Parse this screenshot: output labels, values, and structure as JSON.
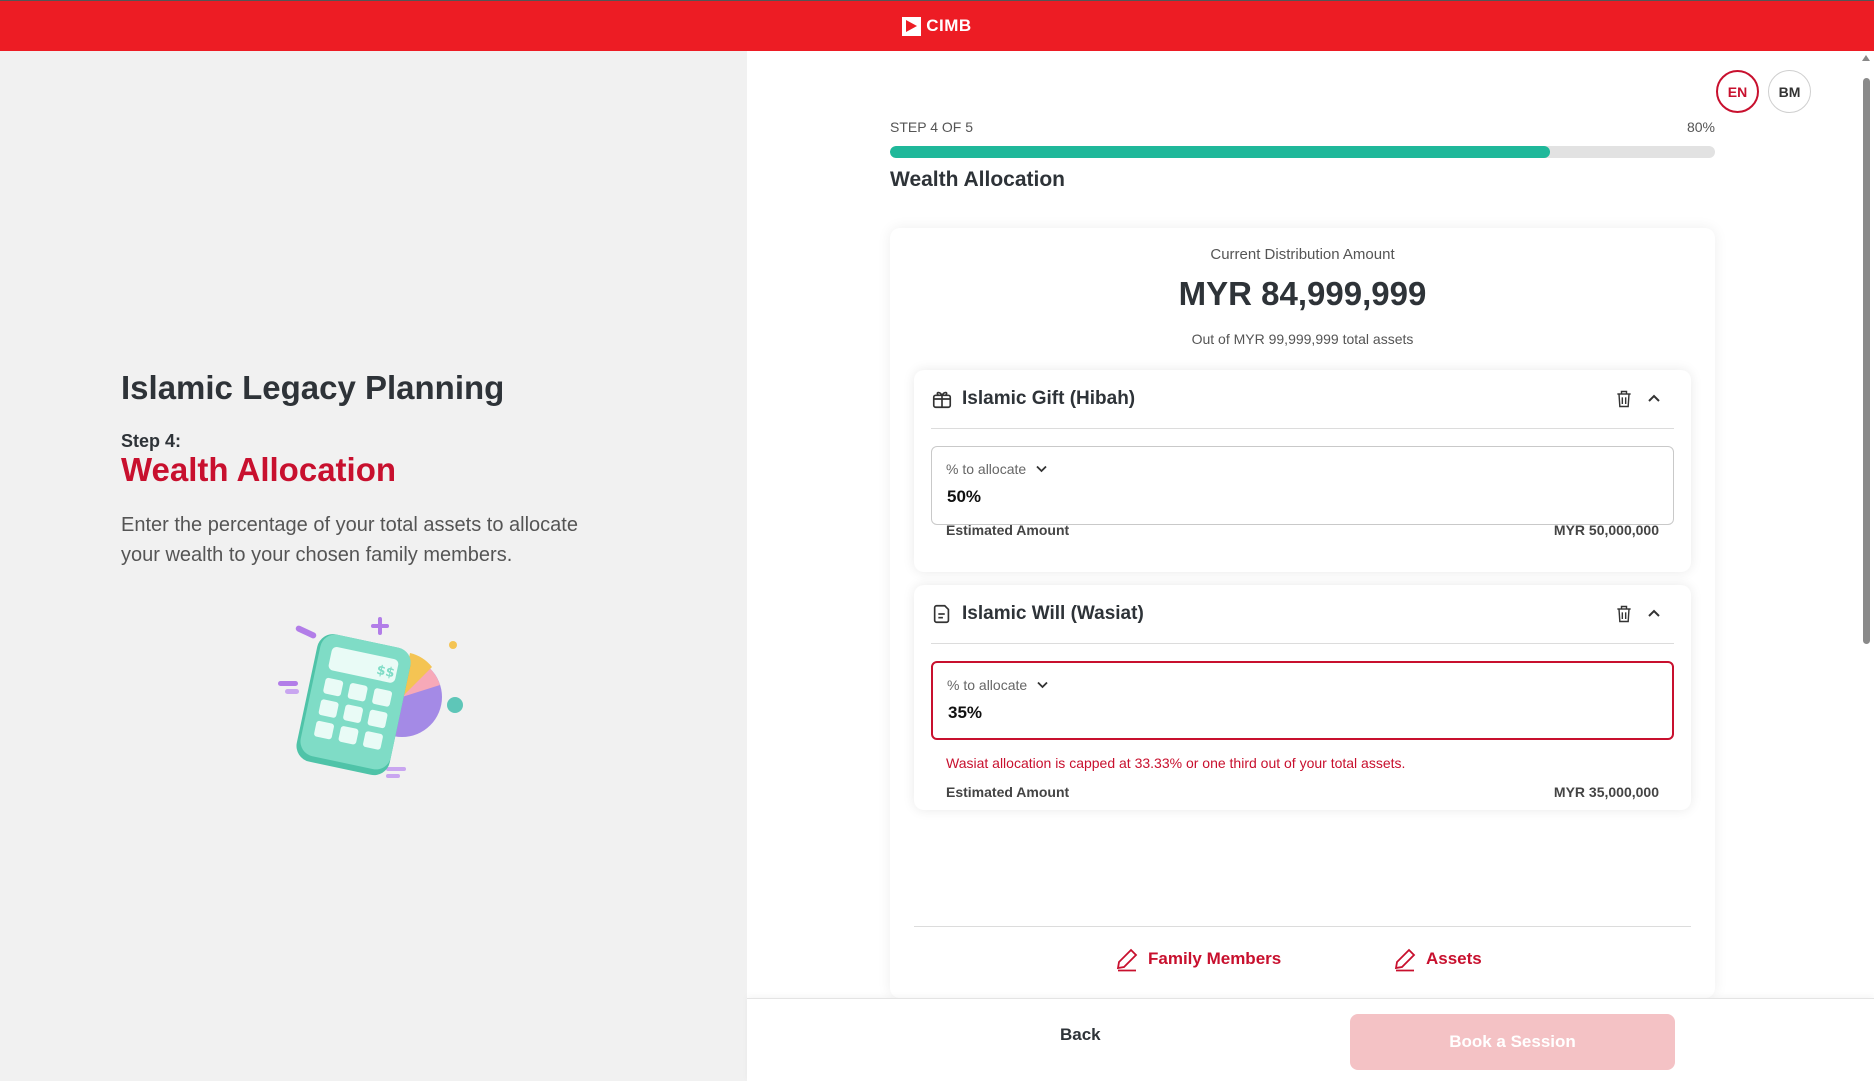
{
  "header": {
    "brand": "CIMB"
  },
  "left_panel": {
    "title": "Islamic Legacy Planning",
    "step_label": "Step 4:",
    "step_title": "Wealth Allocation",
    "description": "Enter the percentage of your total assets to allocate your wealth to your chosen family members."
  },
  "language": {
    "en": "EN",
    "bm": "BM",
    "selected": "EN"
  },
  "progress": {
    "step_text": "STEP 4 OF 5",
    "percent_text": "80%",
    "value": 0.8
  },
  "section_title": "Wealth Allocation",
  "distribution": {
    "label": "Current Distribution Amount",
    "amount": "MYR 84,999,999",
    "subtitle": "Out of MYR 99,999,999 total assets"
  },
  "allocations": [
    {
      "name": "Islamic Gift (Hibah)",
      "icon": "gift-icon",
      "field_label": "% to allocate",
      "value": "50%",
      "error": "",
      "estimated_label": "Estimated Amount",
      "estimated_value": "MYR 50,000,000"
    },
    {
      "name": "Islamic Will (Wasiat)",
      "icon": "document-icon",
      "field_label": "% to allocate",
      "value": "35%",
      "error": "Wasiat allocation is capped at 33.33% or one third out of your total assets.",
      "estimated_label": "Estimated Amount",
      "estimated_value": "MYR 35,000,000"
    }
  ],
  "edit_links": {
    "family": "Family Members",
    "assets": "Assets"
  },
  "footer": {
    "back": "Back",
    "book": "Book a Session"
  },
  "colors": {
    "brand_red": "#ED1C24",
    "accent_red": "#C8102E",
    "progress_green": "#1FB89A",
    "disabled_button": "#F4C2C5"
  }
}
